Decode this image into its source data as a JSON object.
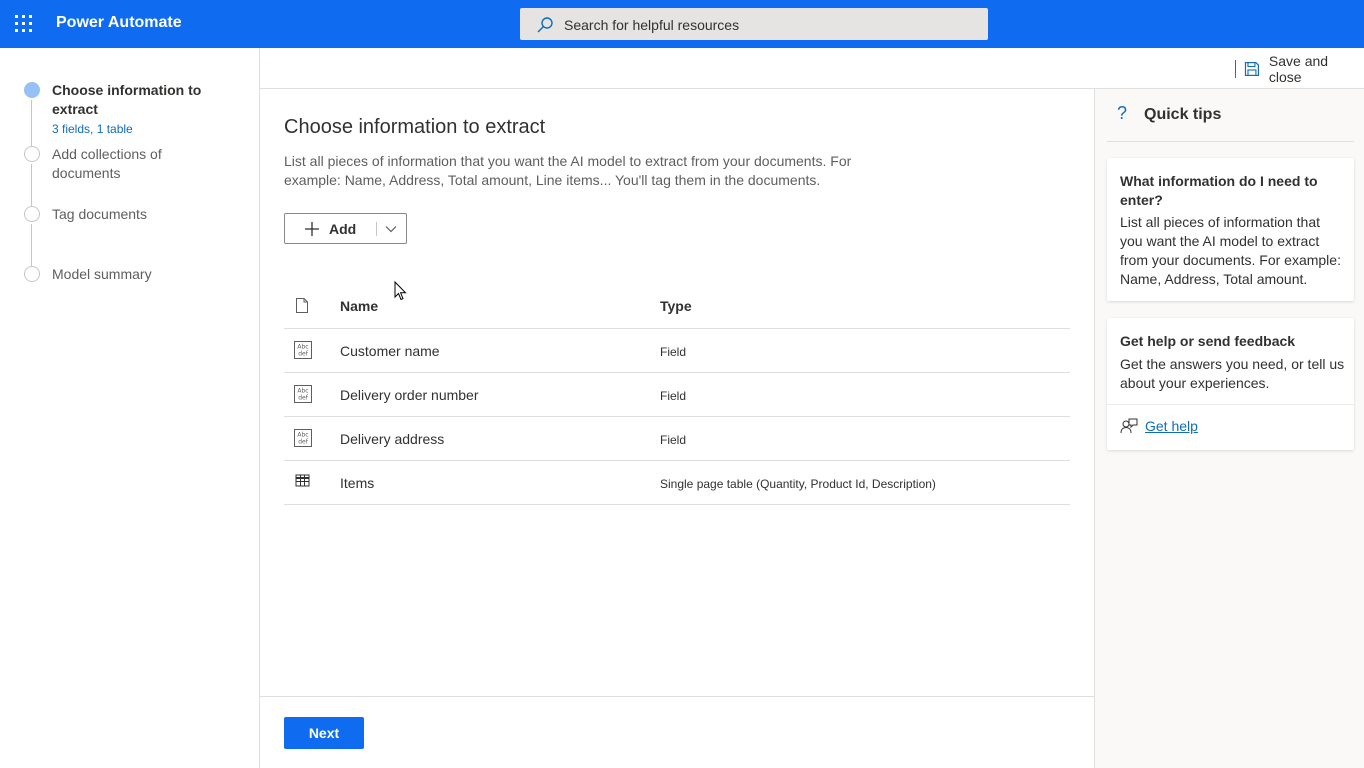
{
  "header": {
    "app_title": "Power Automate",
    "search_placeholder": "Search for helpful resources"
  },
  "sidebar": {
    "steps": [
      {
        "label": "Choose information to extract",
        "sub": "3 fields, 1 table",
        "active": true
      },
      {
        "label": "Add collections of documents"
      },
      {
        "label": "Tag documents"
      },
      {
        "label": "Model summary"
      }
    ]
  },
  "commandbar": {
    "save_label": "Save and close"
  },
  "main": {
    "title": "Choose information to extract",
    "description": "List all pieces of information that you want the AI model to extract from your documents. For example: Name, Address, Total amount, Line items... You'll tag them in the documents.",
    "add_label": "Add",
    "table": {
      "columns": {
        "name": "Name",
        "type": "Type"
      },
      "rows": [
        {
          "name": "Customer name",
          "type": "Field",
          "icon": "text-field-icon"
        },
        {
          "name": "Delivery order number",
          "type": "Field",
          "icon": "text-field-icon"
        },
        {
          "name": "Delivery address",
          "type": "Field",
          "icon": "text-field-icon"
        },
        {
          "name": "Items",
          "type": "Single page table (Quantity, Product Id, Description)",
          "icon": "table-icon"
        }
      ]
    }
  },
  "footer": {
    "next_label": "Next"
  },
  "quick_tips": {
    "title": "Quick tips",
    "cards": [
      {
        "title": "What information do I need to enter?",
        "body": "List all pieces of information that you want the AI model to extract from your documents. For example: Name, Address, Total amount."
      },
      {
        "title": "Get help or send feedback",
        "body": "Get the answers you need, or tell us about your experiences.",
        "link": "Get help"
      }
    ]
  },
  "colors": {
    "brand": "#0f6cf0",
    "link": "#0f6cbd",
    "active_step": "#97c0f7"
  }
}
